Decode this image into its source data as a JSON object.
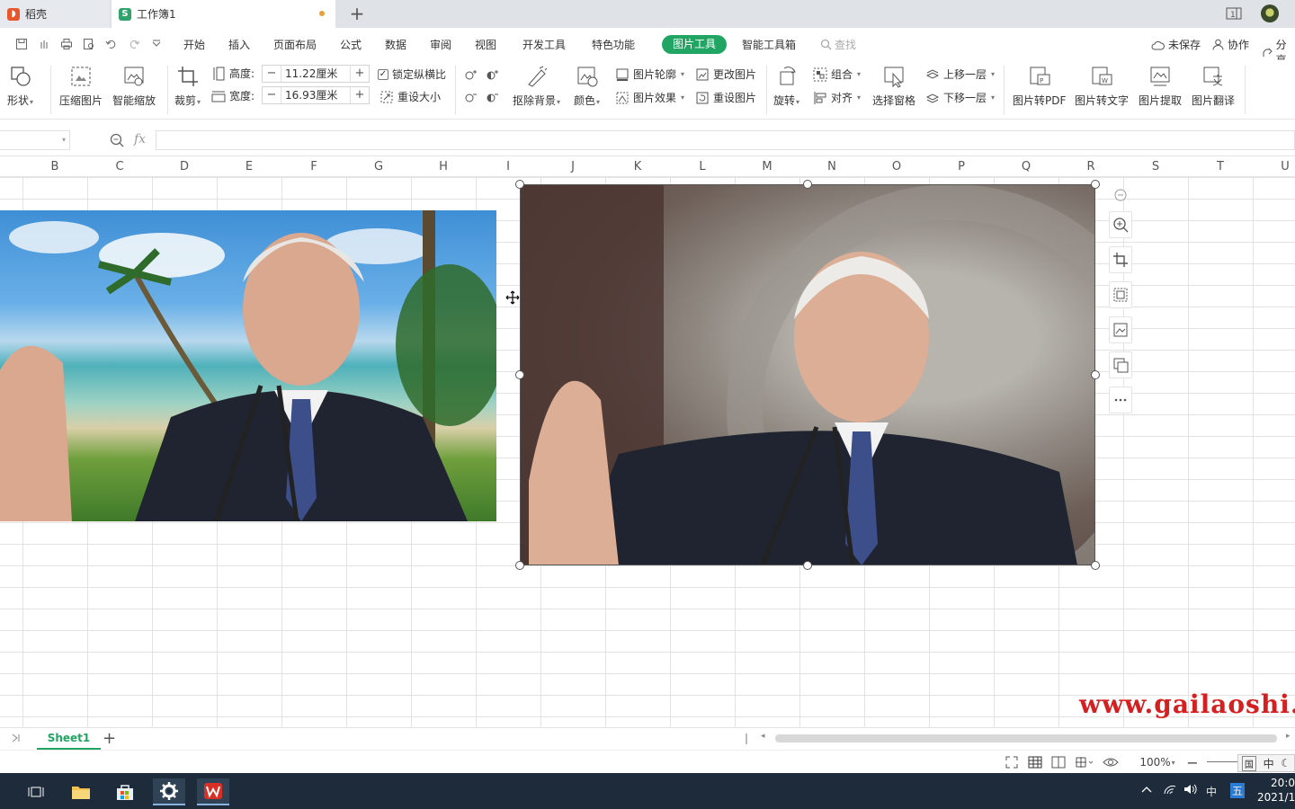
{
  "tabs": [
    {
      "label": "稻壳"
    },
    {
      "label": "工作簿1"
    }
  ],
  "menu": {
    "items": [
      "开始",
      "插入",
      "页面布局",
      "公式",
      "数据",
      "审阅",
      "视图",
      "开发工具",
      "特色功能"
    ],
    "active": "图片工具",
    "after_active": "智能工具箱",
    "search": "查找",
    "unsaved": "未保存",
    "collab": "协作",
    "share": "分享"
  },
  "ribbon": {
    "shape": "形状",
    "compress": "压缩图片",
    "smart_zoom": "智能缩放",
    "crop": "裁剪",
    "height_label": "高度:",
    "height_value": "11.22厘米",
    "width_label": "宽度:",
    "width_value": "16.93厘米",
    "minus": "−",
    "plus": "+",
    "lock_ratio": "锁定纵横比",
    "reset_size": "重设大小",
    "remove_bg": "抠除背景",
    "color": "颜色",
    "outline": "图片轮廓",
    "effect": "图片效果",
    "change_pic": "更改图片",
    "reset_pic": "重设图片",
    "rotate": "旋转",
    "group": "组合",
    "align": "对齐",
    "select_pane": "选择窗格",
    "bring_forward": "上移一层",
    "send_backward": "下移一层",
    "to_pdf": "图片转PDF",
    "to_text": "图片转文字",
    "extract": "图片提取",
    "translate": "图片翻译"
  },
  "formula": {
    "fx": "fx"
  },
  "columns": [
    "B",
    "C",
    "D",
    "E",
    "F",
    "G",
    "H",
    "I",
    "J",
    "K",
    "L",
    "M",
    "N",
    "O",
    "P",
    "Q",
    "R",
    "S",
    "T",
    "U"
  ],
  "watermark": "www.gailaoshi.",
  "sheets": [
    {
      "label": "Sheet1"
    }
  ],
  "status": {
    "zoom": "100%",
    "ime_lang": "中"
  },
  "taskbar": {
    "tray_lang": "中",
    "tray_ime": "五",
    "time": "20:0",
    "date": "2021/1"
  }
}
